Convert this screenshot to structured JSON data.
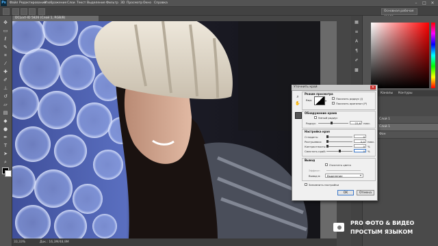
{
  "app": {
    "logo": "Ps"
  },
  "menubar": {
    "items": [
      "Файл",
      "Редактирование",
      "Изображение",
      "Слои",
      "Текст",
      "Выделение",
      "Фильтр",
      "3D",
      "Просмотр",
      "Окно",
      "Справка"
    ]
  },
  "window_controls": {
    "minimize": "–",
    "maximize": "□",
    "close": "✕"
  },
  "optionsbar": {
    "workspace_label": "Основная рабочая среда"
  },
  "document": {
    "tab_title": "DCLoct-ID 5826 (Слой 1, RGB/8)",
    "zoom": "33,33%",
    "doc_info": "Док.: 16,3M/48,9M"
  },
  "panels": {
    "layers_tabs": [
      "Слои",
      "Каналы",
      "Контуры"
    ],
    "layer_names": [
      "Слой 1",
      "Слой 1",
      "Фон"
    ]
  },
  "dialog": {
    "title": "Уточнить край",
    "close": "✕",
    "view_mode": {
      "heading": "Режим просмотра",
      "view_label": "Вид:",
      "show_radius": "Показать радиус (J)",
      "show_original": "Показать оригинал (P)"
    },
    "edge_detection": {
      "heading": "Обнаружение краев",
      "smart_radius": "Умный радиус",
      "radius_label": "Радиус:",
      "radius_value": "22,6",
      "radius_unit": "пикс."
    },
    "adjust_edge": {
      "heading": "Настройка края",
      "smooth_label": "Сгладить:",
      "smooth_value": "0",
      "feather_label": "Растушевка:",
      "feather_value": "0,0",
      "feather_unit": "пикс.",
      "contrast_label": "Контрастность:",
      "contrast_value": "0",
      "contrast_unit": "%",
      "shift_label": "Сместить край:",
      "shift_value": "0",
      "shift_unit": "%"
    },
    "output": {
      "heading": "Вывод",
      "decontaminate": "Очистить цвета",
      "amount_label": "Эффект:",
      "output_to_label": "Вывод в:",
      "output_to_value": "Выделение"
    },
    "remember": "Запомнить настройки",
    "ok": "OK",
    "cancel": "Отмена"
  },
  "watermark": {
    "line1": "PRO ФОТО & ВИДЕО",
    "line2": "ПРОСТЫМ ЯЗЫКОМ"
  },
  "colors": {
    "accent": "#3a77c9",
    "bokeh": "#8fa6e8",
    "hat": "#e8dfcf"
  }
}
